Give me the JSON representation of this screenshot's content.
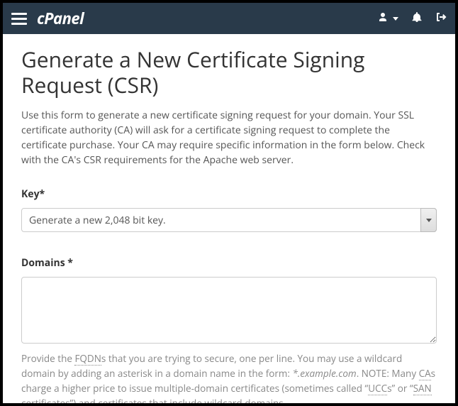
{
  "header": {
    "logo_text": "cPanel"
  },
  "page": {
    "title": "Generate a New Certificate Signing Request (CSR)",
    "description": "Use this form to generate a new certificate signing request for your domain. Your SSL certificate authority (CA) will ask for a certificate signing request to complete the certificate purchase. Your CA may require specific information in the form below. Check with the CA's CSR requirements for the Apache web server."
  },
  "form": {
    "key": {
      "label": "Key*",
      "selected": "Generate a new 2,048 bit key."
    },
    "domains": {
      "label": "Domains *",
      "value": "",
      "help_pre": "Provide the ",
      "help_fqdn": "FQDN",
      "help_mid1": "s that you are trying to secure, one per line. You may use a wildcard domain by adding an asterisk in a domain name in the form: ",
      "help_example": "*.example.com",
      "help_mid2": ". NOTE: Many ",
      "help_ca": "CA",
      "help_mid3": "s charge a higher price to issue multiple-domain certificates (sometimes called “",
      "help_ucc": "UCC",
      "help_mid4": "s” or “",
      "help_san": "SAN",
      "help_mid5": " certificates”) and certificates that include wildcard domains."
    }
  }
}
